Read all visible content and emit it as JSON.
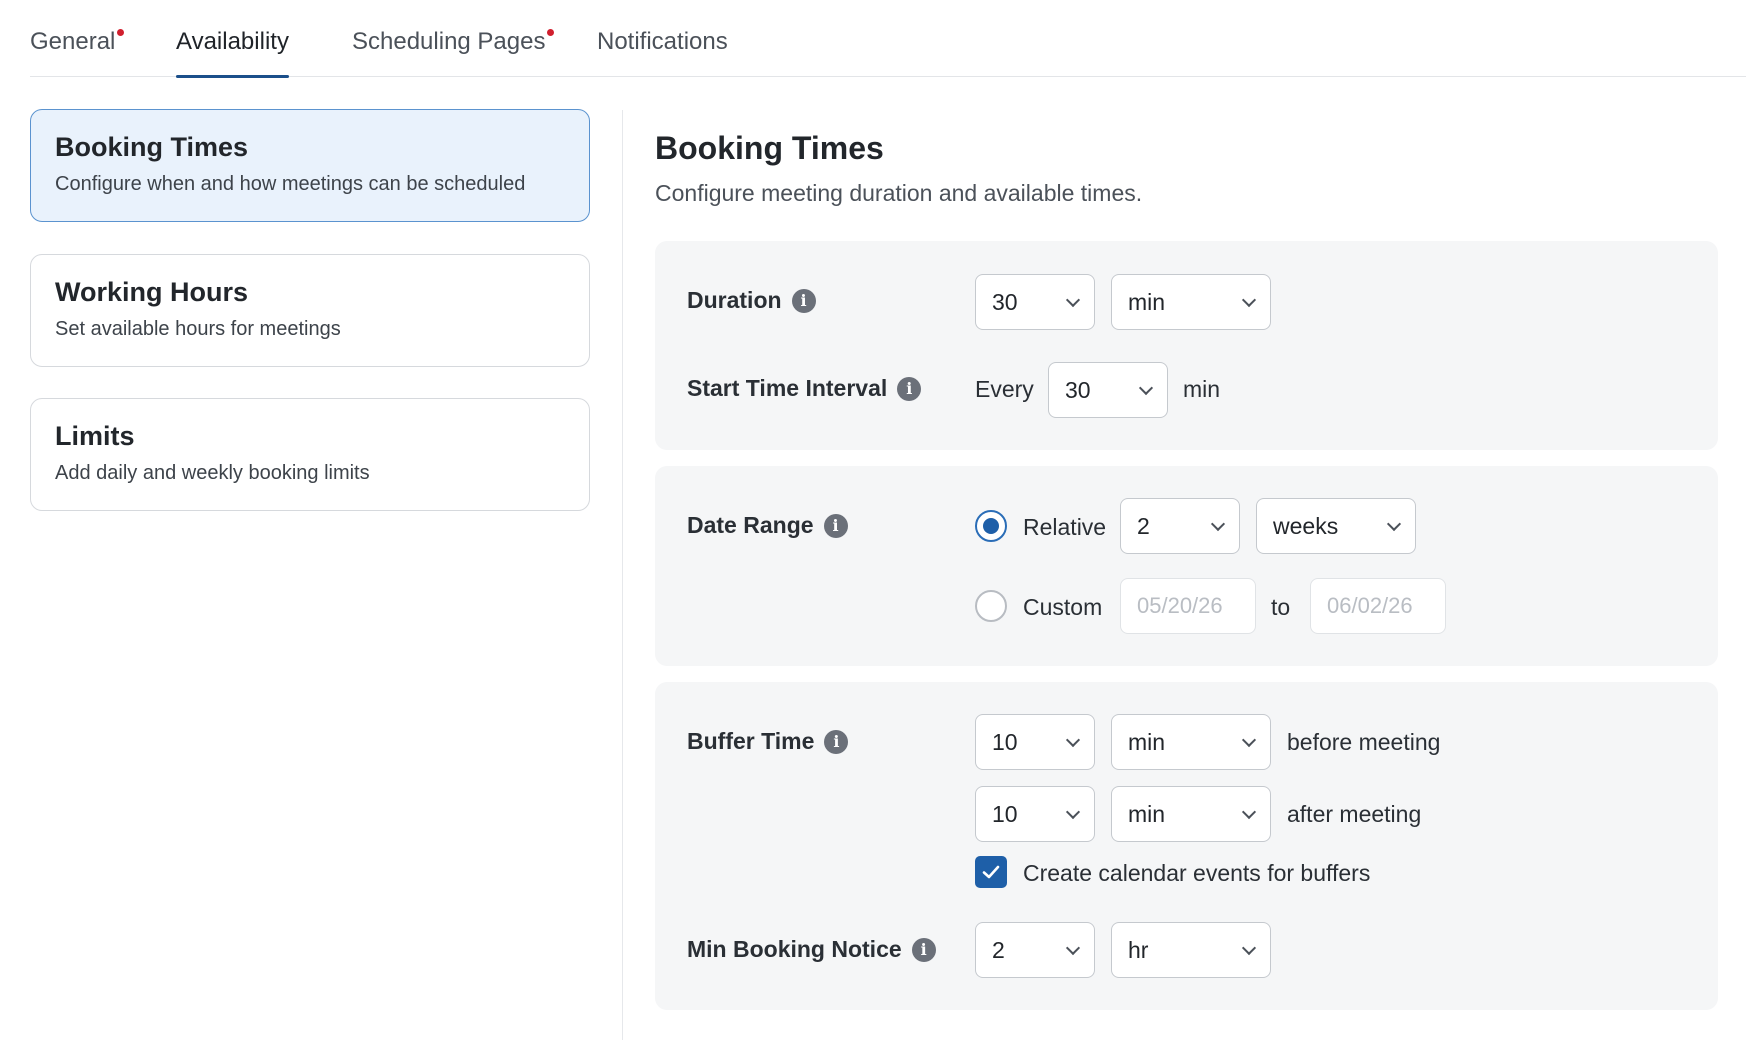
{
  "tabs": [
    {
      "label": "General",
      "alert": true
    },
    {
      "label": "Availability",
      "active": true
    },
    {
      "label": "Scheduling Pages",
      "alert": true
    },
    {
      "label": "Notifications"
    }
  ],
  "nav": [
    {
      "title": "Booking Times",
      "desc": "Configure when and how meetings can be scheduled",
      "selected": true
    },
    {
      "title": "Working Hours",
      "desc": "Set available hours for meetings"
    },
    {
      "title": "Limits",
      "desc": "Add daily and weekly booking limits"
    }
  ],
  "main": {
    "title": "Booking Times",
    "subtitle": "Configure meeting duration and available times."
  },
  "duration": {
    "label": "Duration",
    "value": "30",
    "unit": "min"
  },
  "interval": {
    "label": "Start Time Interval",
    "prefix": "Every",
    "value": "30",
    "suffix": "min"
  },
  "date_range": {
    "label": "Date Range",
    "relative_label": "Relative",
    "relative_value": "2",
    "relative_unit": "weeks",
    "custom_label": "Custom",
    "start_placeholder": "05/20/26",
    "to_label": "to",
    "end_placeholder": "06/02/26",
    "selected": "relative"
  },
  "buffer": {
    "label": "Buffer Time",
    "before_value": "10",
    "before_unit": "min",
    "before_text": "before meeting",
    "after_value": "10",
    "after_unit": "min",
    "after_text": "after meeting",
    "checkbox_label": "Create calendar events for buffers",
    "checkbox_checked": true
  },
  "notice": {
    "label": "Min Booking Notice",
    "value": "2",
    "unit": "hr"
  },
  "icons": {
    "info": "i"
  },
  "colors": {
    "accent": "#1e5fa8",
    "alert_dot": "#d11f2e",
    "selected_card_bg": "#e9f2fc"
  }
}
